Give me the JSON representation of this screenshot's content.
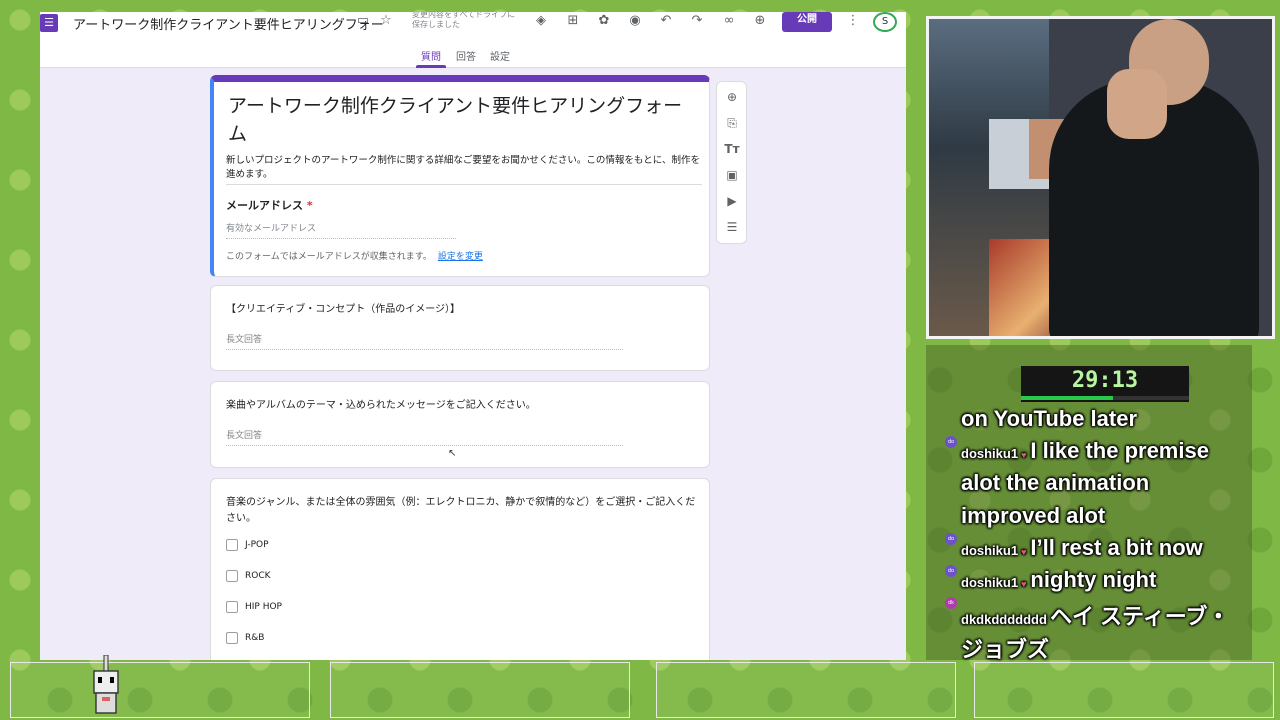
{
  "forms": {
    "doc_title": "アートワーク制作クライアント要件ヒアリングフォー",
    "save_status": "変更内容をすべてドライブに保存しました",
    "publish_label": "公開",
    "account_initial": "S",
    "tabs": [
      {
        "label": "質問",
        "active": true
      },
      {
        "label": "回答",
        "active": false
      },
      {
        "label": "設定",
        "active": false
      }
    ],
    "title_card": {
      "title": "アートワーク制作クライアント要件ヒアリングフォーム",
      "description": "新しいプロジェクトのアートワーク制作に関する詳細なご要望をお聞かせください。この情報をもとに、制作を進めます。",
      "email_label": "メールアドレス",
      "required_mark": "*",
      "email_placeholder": "有効なメールアドレス",
      "collect_note": "このフォームではメールアドレスが収集されます。",
      "change_settings_link": "設定を変更"
    },
    "questions": [
      {
        "title": "【クリエイティブ・コンセプト（作品のイメージ）】",
        "answer_placeholder": "長文回答"
      },
      {
        "title": "楽曲やアルバムのテーマ・込められたメッセージをご記入ください。",
        "answer_placeholder": "長文回答"
      },
      {
        "title": "音楽のジャンル、または全体の雰囲気（例：エレクトロニカ、静かで叙情的など）をご選択・ご記入ください。",
        "options": [
          "J-POP",
          "ROCK",
          "HIP HOP",
          "R&B"
        ]
      }
    ],
    "toolbar_icons": [
      "add-question-icon",
      "import-questions-icon",
      "add-title-icon",
      "add-image-icon",
      "add-video-icon",
      "add-section-icon"
    ]
  },
  "stream": {
    "timer": "29:13",
    "timer_progress": 0.55,
    "chat": [
      {
        "user": "",
        "text": "on YouTube later"
      },
      {
        "user": "doshiku1",
        "badge": "do",
        "text": "I like the premise"
      },
      {
        "user": "",
        "text": "alot the animation"
      },
      {
        "user": "",
        "text": "improved alot"
      },
      {
        "user": "doshiku1",
        "badge": "do",
        "text": "I’ll rest a bit now"
      },
      {
        "user": "doshiku1",
        "badge": "do",
        "text": "nighty night"
      },
      {
        "user": "dkdkddddddd",
        "badge": "dk",
        "text": "ヘイ スティーブ・"
      },
      {
        "user": "",
        "text": "ジョブズ"
      }
    ]
  },
  "colors": {
    "forms_purple": "#673ab7",
    "forms_bg": "#f0ebf8",
    "timer_text": "#b8f5a0",
    "timer_bar": "#29c94a",
    "stream_bg": "#7fb844"
  }
}
